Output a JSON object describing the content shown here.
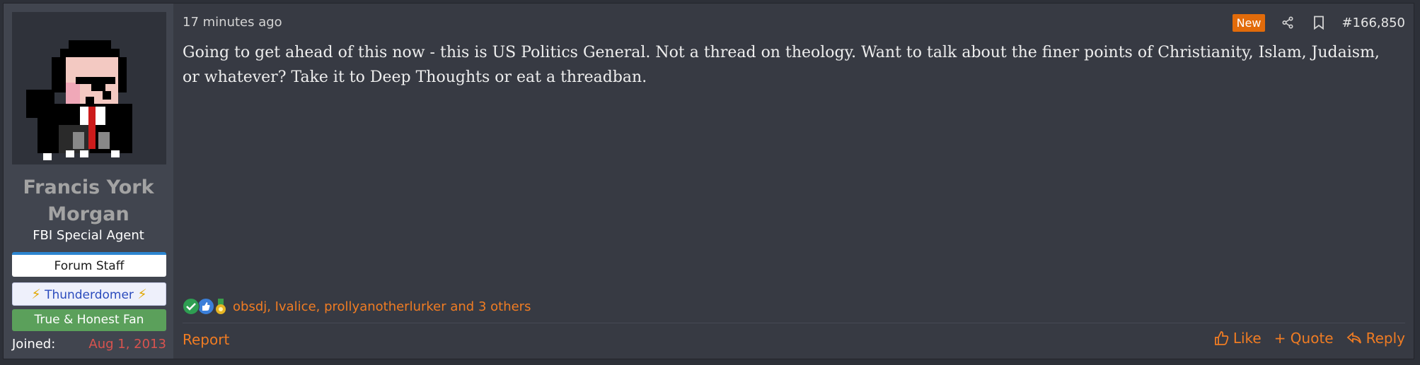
{
  "user": {
    "name": "Francis York Morgan",
    "title": "FBI Special Agent",
    "banners": {
      "staff": "Forum Staff",
      "thunderdome": "Thunderdomer",
      "fan": "True & Honest Fan"
    },
    "joined_label": "Joined:",
    "joined_date": "Aug 1, 2013"
  },
  "post": {
    "timestamp": "17 minutes ago",
    "new_badge": "New",
    "number": "#166,850",
    "message": "Going to get ahead of this now - this is US Politics General. Not a thread on theology. Want to talk about the finer points of Christianity, Islam, Judaism, or whatever? Take it to Deep Thoughts or eat a threadban.",
    "reactions_text": "obsdj, Ivalice, prollyanotherlurker and 3 others",
    "reaction_icons": [
      "check-icon",
      "thumbs-up-icon",
      "medal-icon"
    ]
  },
  "actions": {
    "report": "Report",
    "like": "Like",
    "quote": "+ Quote",
    "reply": "Reply"
  },
  "colors": {
    "accent": "#f07c23",
    "joined_date": "#d9534f",
    "new_badge": "#e26b0a"
  }
}
